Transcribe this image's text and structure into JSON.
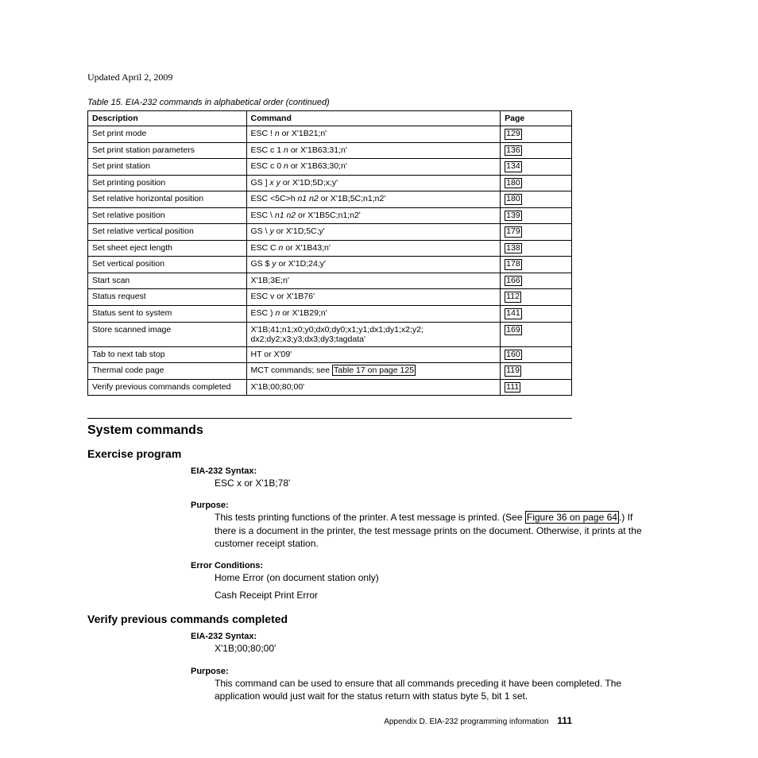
{
  "updated": "Updated April 2, 2009",
  "tableCaption": "Table 15. EIA-232 commands in alphabetical order  (continued)",
  "headers": {
    "desc": "Description",
    "cmd": "Command",
    "page": "Page"
  },
  "rows": [
    {
      "desc": "Set print mode",
      "cmd_pre": "ESC ! ",
      "cmd_it": "n",
      "cmd_post": " or X'1B21;n'",
      "page": "129"
    },
    {
      "desc": "Set print station parameters",
      "cmd_pre": "ESC c 1 ",
      "cmd_it": "n",
      "cmd_post": " or X'1B63;31;n'",
      "page": "136"
    },
    {
      "desc": "Set print station",
      "cmd_pre": "ESC c 0 ",
      "cmd_it": "n",
      "cmd_post": " or X'1B63;30;n'",
      "page": "134"
    },
    {
      "desc": "Set printing position",
      "cmd_pre": "GS ] ",
      "cmd_it": "x y",
      "cmd_post": " or X'1D;5D;x;y'",
      "page": "180"
    },
    {
      "desc": "Set relative horizontal position",
      "cmd_pre": "ESC <5C>h ",
      "cmd_it": "n1 n2",
      "cmd_post": " or X'1B;5C;n1;n2'",
      "page": "180"
    },
    {
      "desc": "Set relative position",
      "cmd_pre": "ESC \\ ",
      "cmd_it": "n1 n2",
      "cmd_post": " or X'1B5C;n1;n2'",
      "page": "139"
    },
    {
      "desc": "Set relative vertical position",
      "cmd_pre": "GS \\ ",
      "cmd_it": "y",
      "cmd_post": " or X'1D;5C;y'",
      "page": "179"
    },
    {
      "desc": "Set sheet eject length",
      "cmd_pre": "ESC C ",
      "cmd_it": "n",
      "cmd_post": " or X'1B43;n'",
      "page": "138"
    },
    {
      "desc": "Set vertical position",
      "cmd_pre": "GS $ ",
      "cmd_it": "y",
      "cmd_post": " or X'1D;24;y'",
      "page": "178"
    },
    {
      "desc": "Start scan",
      "cmd_pre": "X'1B;3E;n'",
      "cmd_it": "",
      "cmd_post": "",
      "page": "166"
    },
    {
      "desc": "Status request",
      "cmd_pre": "ESC v or X'1B76'",
      "cmd_it": "",
      "cmd_post": "",
      "page": "112"
    },
    {
      "desc": "Status sent to system",
      "cmd_pre": "ESC ) ",
      "cmd_it": "n",
      "cmd_post": " or X'1B29;n'",
      "page": "141"
    },
    {
      "desc": "Store scanned image",
      "cmd_pre": "X'1B;41;n1;x0;y0;dx0;dy0;x1;y1;dx1;dy1;x2;y2; dx2;dy2;x3;y3;dx3;dy3;tagdata'",
      "cmd_it": "",
      "cmd_post": "",
      "page": "169"
    },
    {
      "desc": "Tab to next tab stop",
      "cmd_pre": "HT or X'09'",
      "cmd_it": "",
      "cmd_post": "",
      "page": "160"
    },
    {
      "desc": "Thermal code page",
      "cmd_pre": "MCT commands; see ",
      "link": "Table 17 on page 125",
      "cmd_it": "",
      "cmd_post": "",
      "page": "119"
    },
    {
      "desc": "Verify previous commands completed",
      "cmd_pre": "X'1B;00;80;00'",
      "cmd_it": "",
      "cmd_post": "",
      "page": "111"
    }
  ],
  "h2": "System commands",
  "h3a": "Exercise program",
  "exercise": {
    "syntaxLabel": "EIA-232 Syntax:",
    "syntaxBody": "ESC x or X'1B;78'",
    "purposeLabel": "Purpose:",
    "purposeBody1": "This tests printing functions of the printer. A test message is printed. (See ",
    "purposeLink": "Figure 36 on page 64",
    "purposeBody2": ".) If there is a document in the printer, the test message prints on the document. Otherwise, it prints at the customer receipt station.",
    "errLabel": "Error Conditions:",
    "err1": "Home Error (on document station only)",
    "err2": "Cash Receipt Print Error"
  },
  "h3b": "Verify previous commands completed",
  "verify": {
    "syntaxLabel": "EIA-232 Syntax:",
    "syntaxBody": "X'1B;00;80;00'",
    "purposeLabel": "Purpose:",
    "purposeBody": "This command can be used to ensure that all commands preceding it have been completed. The application would just wait for the status return with status byte 5, bit 1 set."
  },
  "footer": {
    "text": "Appendix D. EIA-232 programming information",
    "page": "111"
  }
}
